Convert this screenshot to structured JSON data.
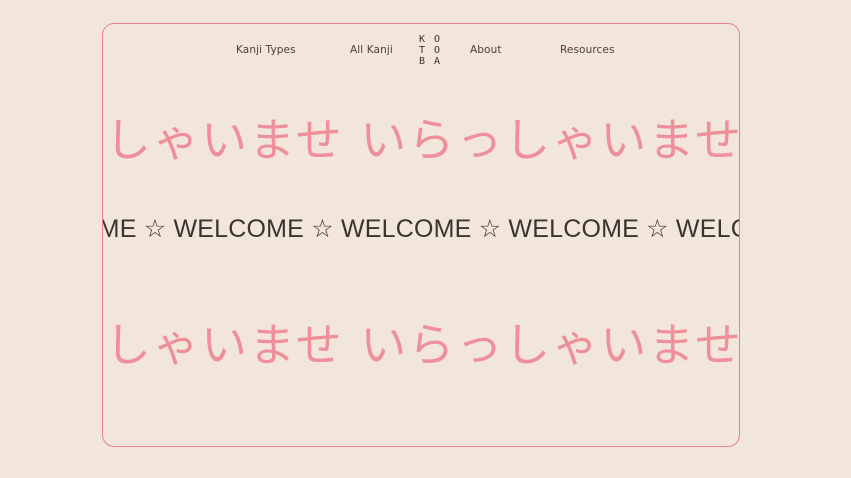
{
  "nav": {
    "kanji_types": "Kanji Types",
    "all_kanji": "All  Kanji",
    "about": "About",
    "resources": "Resources"
  },
  "logo": {
    "line1": "K O",
    "line2": "T O",
    "line3": "B A"
  },
  "marquee": {
    "japanese_top": "いらっしゃいませ いらっしゃいませ いらっしゃいませ",
    "welcome": "WELCOME ☆ WELCOME ☆ WELCOME ☆ WELCOME ☆ WELCOME ☆",
    "japanese_bottom": "いらっしゃいませ いらっしゃいませ いらっしゃいませ"
  },
  "colors": {
    "background": "#f2e6db",
    "border": "#e8828f",
    "japanese_text": "#ef8f9c",
    "welcome_text": "#3a3430"
  }
}
